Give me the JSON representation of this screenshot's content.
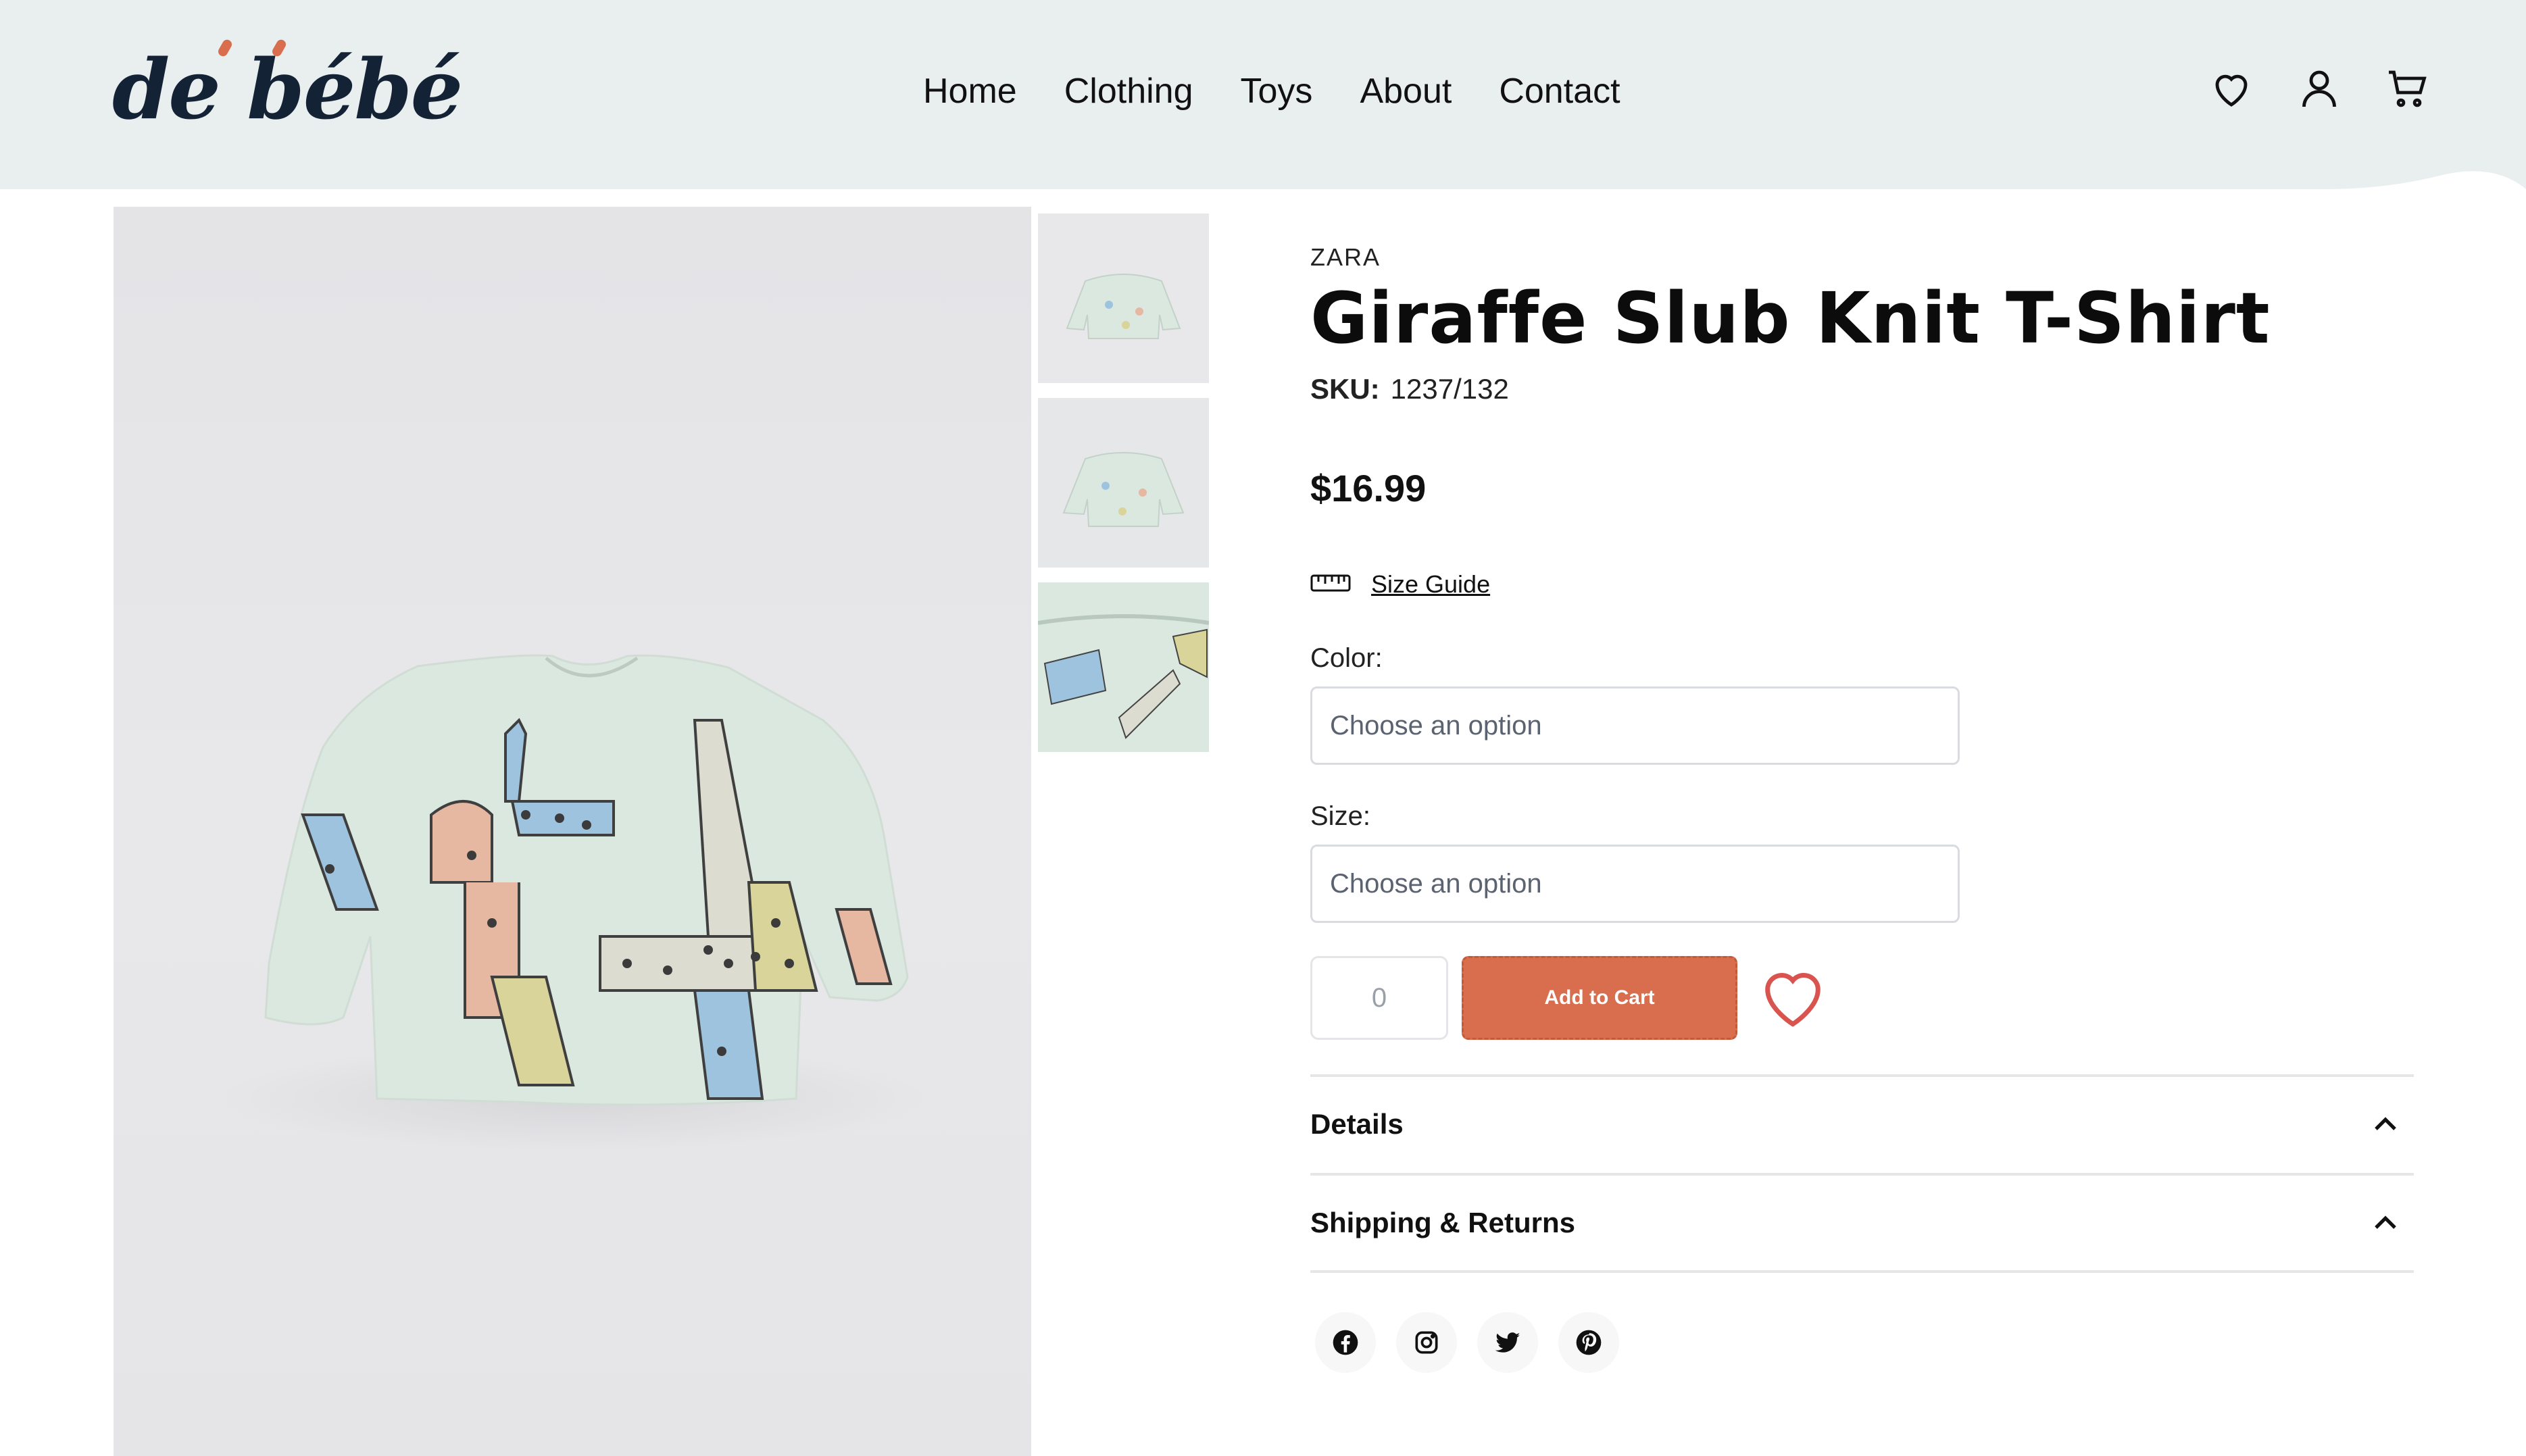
{
  "header": {
    "logo_text": "de bébé",
    "nav": [
      "Home",
      "Clothing",
      "Toys",
      "About",
      "Contact"
    ],
    "icons": [
      "heart-icon",
      "user-icon",
      "cart-icon"
    ]
  },
  "product": {
    "brand": "ZARA",
    "title": "Giraffe Slub Knit T-Shirt",
    "sku_label": "SKU:",
    "sku": "1237/132",
    "price": "$16.99",
    "size_guide": "Size Guide",
    "color_label": "Color:",
    "color_placeholder": "Choose an option",
    "size_label": "Size:",
    "size_placeholder": "Choose an option",
    "quantity": "0",
    "add_to_cart": "Add to Cart",
    "accordion": [
      "Details",
      "Shipping & Returns"
    ],
    "socials": [
      "facebook-icon",
      "instagram-icon",
      "twitter-icon",
      "pinterest-icon"
    ]
  },
  "colors": {
    "header_bg": "#e9eeef",
    "accent": "#d86e4d",
    "wishlist_heart": "#d9534f",
    "shirt": "#dbe8df"
  }
}
